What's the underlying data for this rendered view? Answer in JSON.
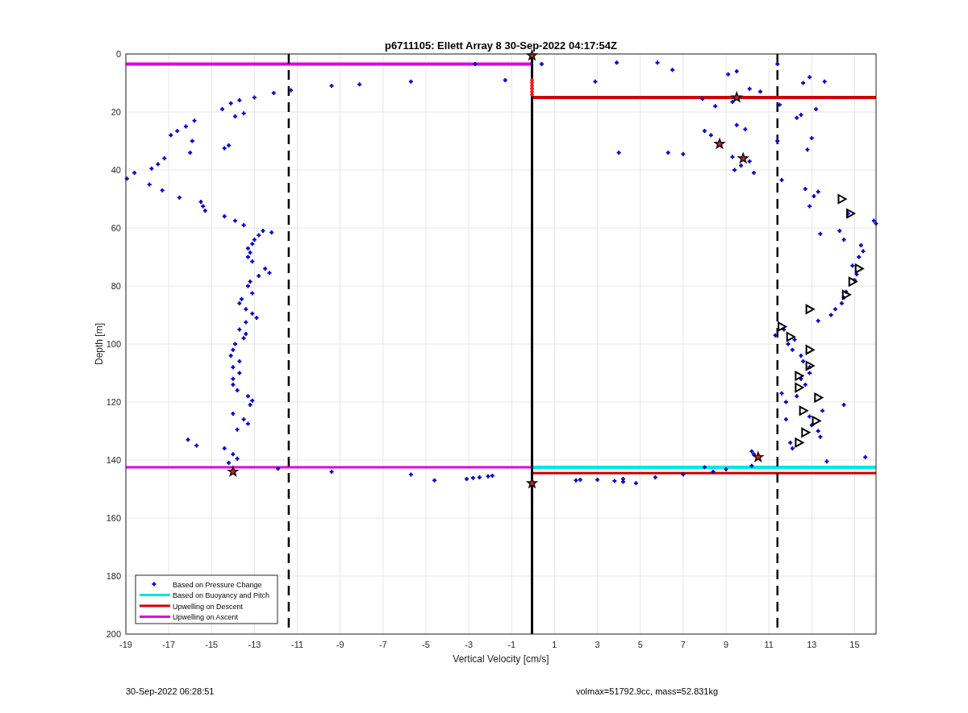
{
  "figure": {
    "footer_left": "30-Sep-2022 06:28:51",
    "footer_right": "volmax=51792.9cc, mass=52.831kg"
  },
  "chart_data": {
    "type": "scatter",
    "grid": true,
    "legend": true,
    "title": "p6711105: Ellett Array 8 30-Sep-2022 04:17:54Z",
    "xlabel": "Vertical Velocity [cm/s]",
    "ylabel": "Depth [m]",
    "xlim": [
      -19,
      16
    ],
    "ylim": [
      200,
      0
    ],
    "xticks": [
      -19,
      -17,
      -15,
      -13,
      -11,
      -9,
      -7,
      -5,
      -3,
      -1,
      1,
      3,
      5,
      7,
      9,
      11,
      13,
      15
    ],
    "yticks": [
      0,
      20,
      40,
      60,
      80,
      100,
      120,
      140,
      160,
      180,
      200
    ],
    "series": [
      {
        "name": "Based on Pressure Change",
        "type": "scatter",
        "marker": "cross",
        "color": "#0000cc",
        "x": [
          -2.7,
          -1.3,
          -5.7,
          -8.1,
          -9.4,
          -11.3,
          -12.1,
          -13.0,
          -13.7,
          -14.1,
          -14.5,
          -13.5,
          -13.9,
          -15.8,
          -16.2,
          -16.6,
          -16.9,
          -15.9,
          -14.2,
          -14.4,
          -16.0,
          -17.2,
          -17.5,
          -17.8,
          -18.6,
          -18.95,
          -17.9,
          -17.3,
          -16.5,
          -15.5,
          -15.4,
          -15.3,
          -14.4,
          -13.9,
          -13.5,
          -12.6,
          -12.2,
          -12.8,
          -13.0,
          -13.1,
          -13.3,
          -13.2,
          -13.3,
          -13.1,
          -12.5,
          -12.3,
          -12.8,
          -13.2,
          -13.3,
          -13.1,
          -13.6,
          -13.7,
          -13.4,
          -13.1,
          -12.9,
          -13.4,
          -13.7,
          -13.4,
          -13.5,
          -13.9,
          -14.0,
          -14.1,
          -13.7,
          -14.0,
          -13.7,
          -14.0,
          -14.0,
          -13.8,
          -13.3,
          -13.1,
          -13.2,
          -14.0,
          -13.5,
          -13.3,
          -13.8,
          -16.1,
          -15.7,
          -14.4,
          -14.0,
          -13.8,
          -14.2,
          -11.9,
          -9.4,
          -5.7,
          -4.6,
          -3.1,
          -2.8,
          -2.5,
          -2.1,
          -1.9,
          0.4,
          3.9,
          5.8,
          6.5,
          2.9,
          9.1,
          9.5,
          11.4,
          10.1,
          13.6,
          12.9,
          12.6,
          10.6,
          7.9,
          9.3,
          8.5,
          11.5,
          13.2,
          12.3,
          12.5,
          9.5,
          9.9,
          8.0,
          8.3,
          6.3,
          4.0,
          7.0,
          11.4,
          13.0,
          12.8,
          9.3,
          10.1,
          9.7,
          9.4,
          10.3,
          11.6,
          12.7,
          13.3,
          13.1,
          12.9,
          14.7,
          15.9,
          16.0,
          13.4,
          14.3,
          14.5,
          15.3,
          15.4,
          15.2,
          14.9,
          15.1,
          15.0,
          14.6,
          14.5,
          14.4,
          14.1,
          13.9,
          13.3,
          11.7,
          11.3,
          12.2,
          11.9,
          12.1,
          12.5,
          12.6,
          12.9,
          12.9,
          12.5,
          12.7,
          11.6,
          12.3,
          11.8,
          14.5,
          13.5,
          12.9,
          11.8,
          13.0,
          13.3,
          13.4,
          12.0,
          12.1,
          10.2,
          10.3,
          15.5,
          13.7,
          10.2,
          8.0,
          9.0,
          8.4,
          7.0,
          4.2,
          2.0,
          3.0,
          4.2,
          4.8,
          5.7,
          3.8,
          2.2
        ],
        "values": [
          3.5,
          9,
          9.5,
          10.5,
          11,
          12.5,
          13.5,
          15,
          16,
          17,
          19,
          20.5,
          21.5,
          23,
          25,
          26.5,
          28,
          30,
          31.5,
          32.5,
          34,
          36,
          38,
          39.5,
          41,
          43,
          45,
          47,
          49.5,
          51,
          52.5,
          54,
          56,
          57.5,
          59,
          61,
          61.5,
          62.5,
          64,
          65.5,
          67,
          68.5,
          70,
          71.5,
          74,
          75.5,
          76.5,
          78.5,
          80,
          82.5,
          84.5,
          86,
          88,
          89.5,
          91,
          92.5,
          95,
          96.5,
          98,
          100,
          102,
          104,
          106,
          108,
          110,
          112,
          114,
          116,
          118,
          119.5,
          121,
          124,
          126,
          127.5,
          129.5,
          133,
          135,
          136,
          138,
          139.5,
          141,
          143,
          144,
          145,
          147,
          146.5,
          146.2,
          146,
          145.6,
          145.4,
          3.5,
          3,
          3,
          5.5,
          9.5,
          7,
          6,
          3.5,
          12,
          9.5,
          8,
          10,
          13,
          15.5,
          16.5,
          18,
          17.5,
          19,
          22,
          21,
          24.5,
          26,
          26.5,
          28,
          34,
          34,
          34.5,
          30,
          29,
          33,
          35.5,
          37,
          38.5,
          40,
          41,
          43.5,
          46.5,
          47.5,
          49,
          52.5,
          55,
          57.5,
          58.5,
          62,
          61,
          64,
          66,
          68,
          70,
          73,
          76,
          78,
          82,
          84,
          86,
          88,
          90,
          92,
          95,
          97,
          98.5,
          100,
          102,
          104,
          106,
          108,
          110,
          112,
          114,
          117,
          118,
          120,
          121,
          123,
          125,
          126,
          128,
          130,
          132,
          134,
          136,
          137,
          138,
          139,
          140.5,
          142,
          142.5,
          143.2,
          144,
          145,
          146.5,
          147,
          146.8,
          147.5,
          148,
          146,
          147.2,
          146.8
        ]
      },
      {
        "name": "Based on Buoyancy and Pitch",
        "type": "line",
        "color": "#00e5e5",
        "x": [
          0,
          16
        ],
        "values": [
          142.5,
          142.5
        ]
      },
      {
        "name": "Upwelling on Descent",
        "type": "line",
        "color": "#d00000",
        "x": [
          0,
          16
        ],
        "values": [
          15,
          15
        ]
      },
      {
        "name": "Upwelling on Ascent",
        "type": "line",
        "color": "#e000e0",
        "x": [
          -19,
          0
        ],
        "values": [
          3.5,
          3.5
        ]
      },
      {
        "type": "line",
        "color": "#e000e0",
        "x": [
          -19,
          0
        ],
        "values": [
          142.5,
          142.5
        ]
      },
      {
        "type": "line",
        "color": "#d00000",
        "x": [
          0,
          16
        ],
        "values": [
          144.5,
          144.5
        ]
      },
      {
        "type": "line",
        "color": "#000000",
        "x": [
          -0.05,
          -0.05
        ],
        "values": [
          0,
          200
        ]
      },
      {
        "type": "line",
        "line_style": "dashed",
        "color": "#000000",
        "x": [
          -11.4,
          -11.4
        ],
        "values": [
          0,
          200
        ]
      },
      {
        "type": "line",
        "line_style": "dashed",
        "color": "#000000",
        "x": [
          11.4,
          11.4
        ],
        "values": [
          0,
          200
        ]
      },
      {
        "type": "scatter",
        "marker": "triangle",
        "color": "#000000",
        "x": [
          14.4,
          14.8,
          15.2,
          14.9,
          14.6,
          12.9,
          11.6,
          12.0,
          12.9,
          12.9,
          12.4,
          12.4,
          13.3,
          12.6,
          13.2,
          12.7,
          12.4
        ],
        "values": [
          50,
          55,
          74,
          78.5,
          83,
          88,
          94,
          97.5,
          102,
          107.5,
          111,
          115,
          118.5,
          123,
          126.5,
          130.5,
          134
        ]
      },
      {
        "type": "scatter",
        "marker": "star",
        "color": "#cc2222",
        "x": [
          -0.05,
          9.5,
          8.7,
          9.8,
          10.5,
          -14.0,
          -0.05
        ],
        "values": [
          0.5,
          15,
          31,
          36,
          139,
          144,
          148
        ]
      },
      {
        "type": "scatter",
        "marker": "cross",
        "color": "#ff2222",
        "x": [
          -0.05,
          -0.05,
          -0.05,
          -0.05,
          -0.05,
          -0.05
        ],
        "values": [
          9,
          10,
          11,
          12,
          13,
          14
        ]
      }
    ]
  }
}
